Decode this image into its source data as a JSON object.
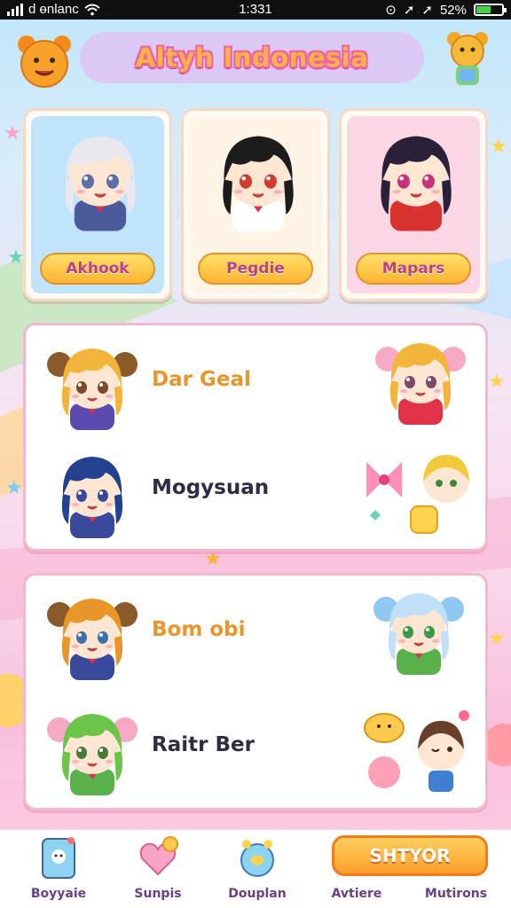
{
  "status_bar": {
    "carrier": "d өnlanc",
    "time": "1:331",
    "battery": "52%"
  },
  "header": {
    "title": "Altyh Indonesia"
  },
  "featured": [
    {
      "label": "Akhook",
      "hair": "#e8e8ee",
      "eyes": "#5a6ea8",
      "outfit": "#4a5a9a",
      "bg": "#bfe4fb"
    },
    {
      "label": "Pegdie",
      "hair": "#1c1c1c",
      "eyes": "#d23a2a",
      "outfit": "#ffffff",
      "bg": "#fff4e6"
    },
    {
      "label": "Mapars",
      "hair": "#2a2038",
      "eyes": "#c9327a",
      "outfit": "#d8322e",
      "bg": "#fbd6e4"
    }
  ],
  "panel_one": {
    "rows": [
      {
        "label": "Dar Geal",
        "label_color": "#e8962a",
        "hair": "#f2b43a",
        "eyes": "#7a4a2a"
      },
      {
        "label": "Mogysuan",
        "label_color": "#2d2d44",
        "hair": "#24418f",
        "eyes": "#3a4a9a"
      }
    ]
  },
  "panel_two": {
    "rows": [
      {
        "label": "Bom obi",
        "label_color": "#e8962a",
        "hair": "#e8962a",
        "eyes": "#3d6fb0"
      },
      {
        "label": "Raitr Ber",
        "label_color": "#2d2d44",
        "hair": "#6cc44a",
        "eyes": "#4a7a3a"
      }
    ]
  },
  "bottom_nav": {
    "items": [
      {
        "label": "Boyyaie",
        "icon": "card-icon"
      },
      {
        "label": "Sunpis",
        "icon": "heart-icon"
      },
      {
        "label": "Douplan",
        "icon": "shield-icon"
      },
      {
        "label": "Avtiere",
        "icon": ""
      },
      {
        "label": "Mutirons",
        "icon": ""
      }
    ],
    "shop_label": "SHTYOR"
  },
  "colors": {
    "accent_orange": "#ffb431",
    "accent_pink": "#f062a8",
    "header_pill": "#dcc8f5"
  }
}
